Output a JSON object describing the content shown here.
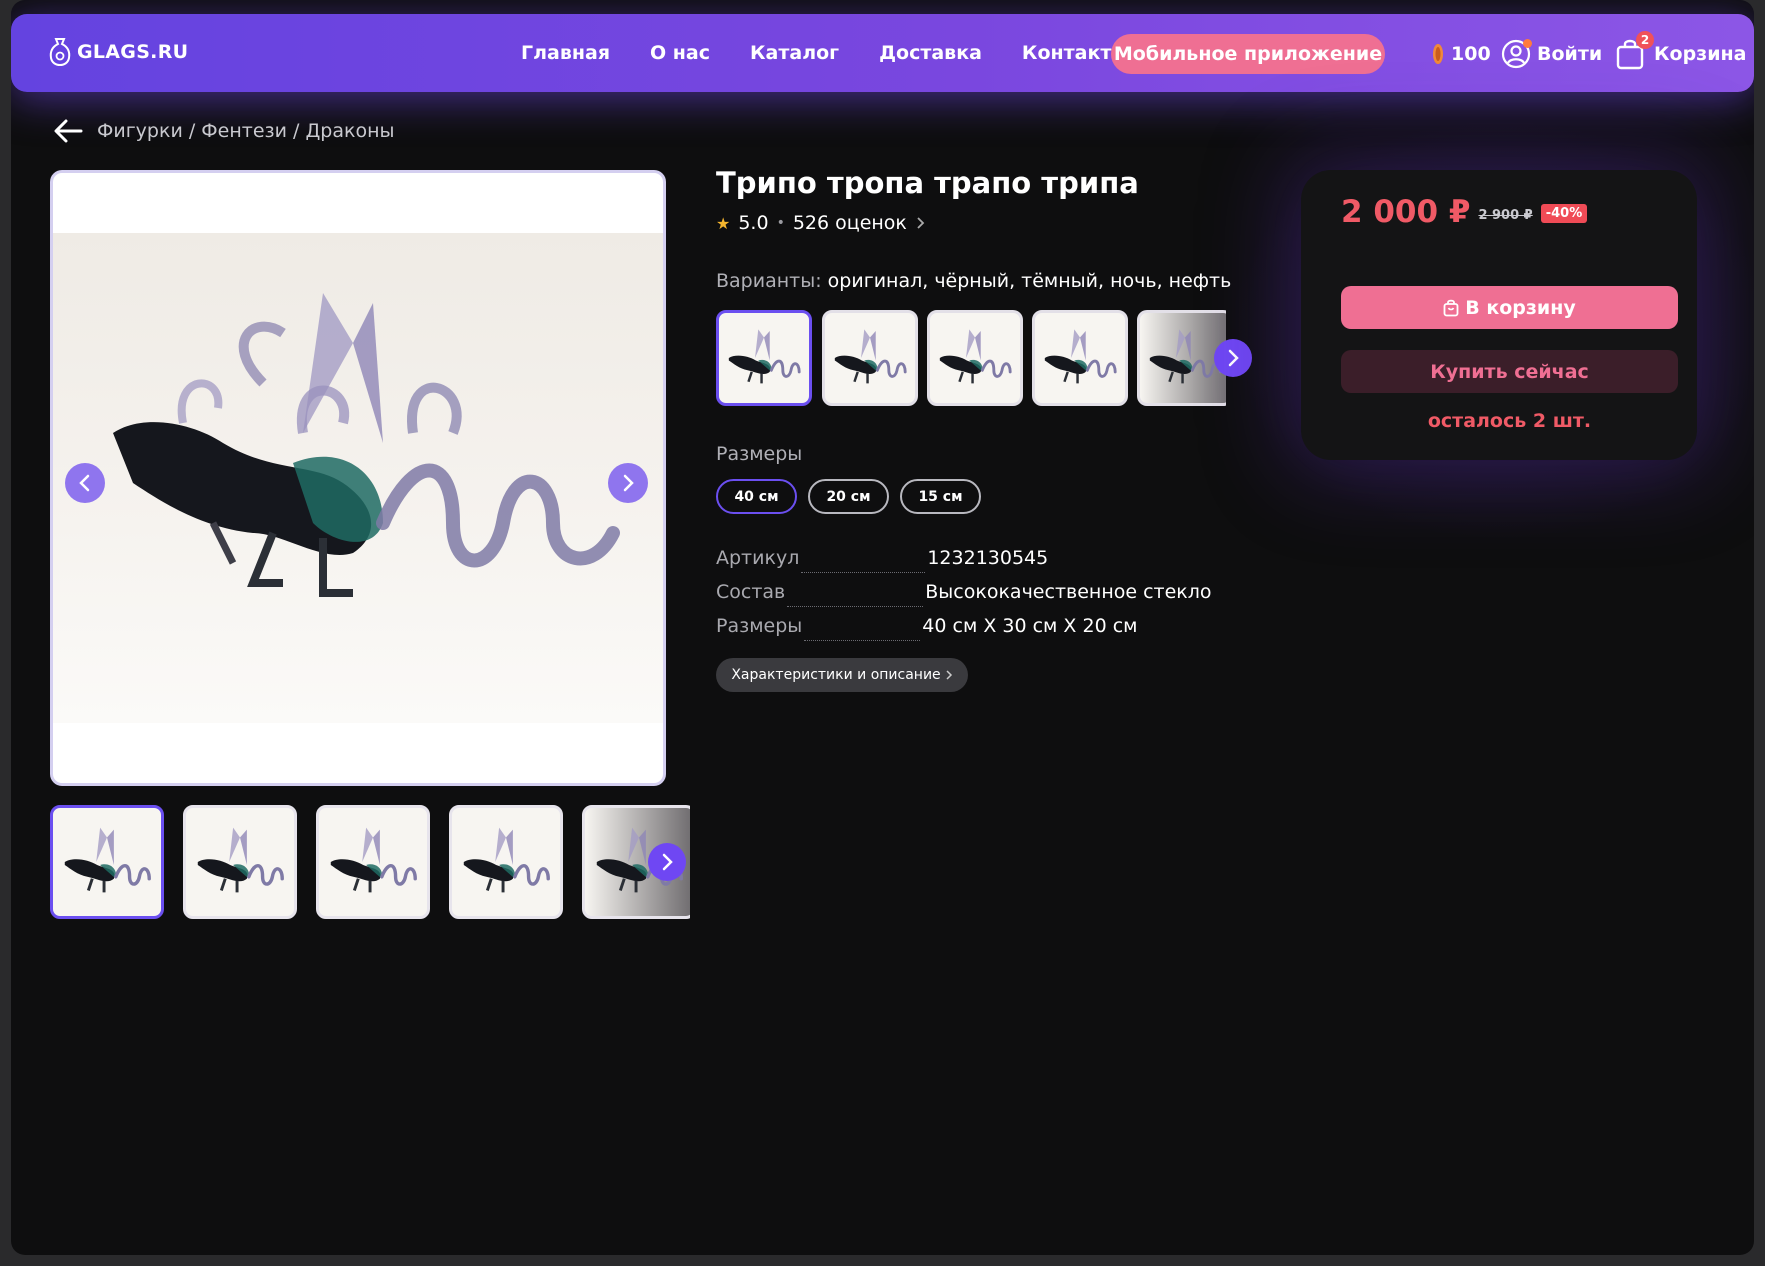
{
  "header": {
    "logo_text": "GLAGS.RU",
    "nav": [
      "Главная",
      "О нас",
      "Каталог",
      "Доставка",
      "Контакты"
    ],
    "app_button": "Мобильное приложение",
    "coins": "100",
    "login": "Войти",
    "cart_label": "Корзина",
    "cart_count": "2"
  },
  "breadcrumb": "Фигурки / Фентези / Драконы",
  "product": {
    "title": "Трипо тропа трапо трипа",
    "rating": "5.0",
    "reviews": "526 оценок",
    "variants_label": "Варианты:",
    "variants_value": "оригинал, чёрный, тёмный, ночь, нефть",
    "sizes_label": "Размеры",
    "sizes": [
      "40 см",
      "20 см",
      "15 см"
    ],
    "selected_size": "40 см",
    "specs": [
      {
        "key": "Артикул",
        "value": "1232130545"
      },
      {
        "key": "Состав",
        "value": "Высококачественное стекло"
      },
      {
        "key": "Размеры",
        "value": "40 см X 30 см X 20 см"
      }
    ],
    "desc_button": "Характеристики и описание"
  },
  "price": {
    "current": "2 000 ₽",
    "old": "2 900 ₽",
    "discount": "-40%",
    "to_cart": "В корзину",
    "buy_now": "Купить сейчас",
    "stock": "осталось 2 шт."
  },
  "colors": {
    "accent": "#6b4ff0",
    "header": "#7147df",
    "pink": "#ef6f93",
    "red": "#f05a66",
    "background": "#0e0e0f"
  }
}
